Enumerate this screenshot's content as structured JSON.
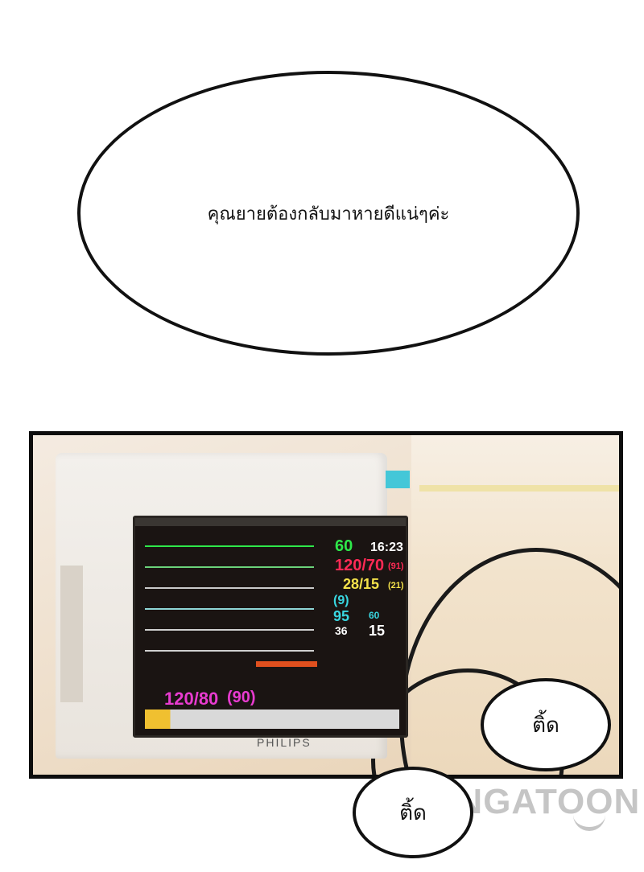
{
  "bubbles": {
    "top": "คุณยายต้องกลับมาหายดีแน่ๆค่ะ",
    "beep_1": "ติ้ด",
    "beep_2": "ติ้ด"
  },
  "monitor": {
    "brand": "PHILIPS",
    "time": "16:23",
    "vitals": {
      "hr": "60",
      "bp_main": "120/70",
      "bp_main_mean": "(91)",
      "pap": "28/15",
      "pap_mean": "(21)",
      "cvp": "(9)",
      "spo2": "95",
      "temp": "36",
      "pr": "60",
      "resp": "15",
      "nibp": "120/80",
      "nibp_mean": "(90)"
    },
    "colors": {
      "hr": "#2ee84a",
      "bp": "#ff2a55",
      "pap": "#f4e24a",
      "spo2": "#39d6e0",
      "nibp": "#e83bd0"
    }
  },
  "watermark": {
    "logo_text": "MANGATOON"
  }
}
